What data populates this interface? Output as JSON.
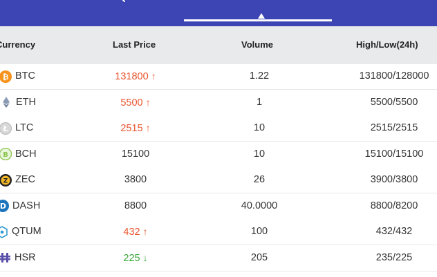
{
  "columns": {
    "currency": "Currency",
    "last_price": "Last Price",
    "volume": "Volume",
    "high_low": "High/Low(24h)"
  },
  "rows": [
    {
      "symbol": "BTC",
      "icon": "bitcoin-icon",
      "price": "131800",
      "trend": "up",
      "volume": "1.22",
      "high_low": "131800/128000"
    },
    {
      "symbol": "ETH",
      "icon": "ethereum-icon",
      "price": "5500",
      "trend": "up",
      "volume": "1",
      "high_low": "5500/5500"
    },
    {
      "symbol": "LTC",
      "icon": "litecoin-icon",
      "price": "2515",
      "trend": "up",
      "volume": "10",
      "high_low": "2515/2515"
    },
    {
      "symbol": "BCH",
      "icon": "bitcoin-cash-icon",
      "price": "15100",
      "trend": "none",
      "volume": "10",
      "high_low": "15100/15100"
    },
    {
      "symbol": "ZEC",
      "icon": "zcash-icon",
      "price": "3800",
      "trend": "none",
      "volume": "26",
      "high_low": "3900/3800"
    },
    {
      "symbol": "DASH",
      "icon": "dash-icon",
      "price": "8800",
      "trend": "none",
      "volume": "40.0000",
      "high_low": "8800/8200"
    },
    {
      "symbol": "QTUM",
      "icon": "qtum-icon",
      "price": "432",
      "trend": "up",
      "volume": "100",
      "high_low": "432/432"
    },
    {
      "symbol": "HSR",
      "icon": "hshare-icon",
      "price": "225",
      "trend": "down",
      "volume": "205",
      "high_low": "235/225"
    }
  ],
  "colors": {
    "header_bar": "#3d45b4",
    "price_up": "#e8542e",
    "price_down": "#3aa93a",
    "table_header_bg": "#e9eaec"
  }
}
